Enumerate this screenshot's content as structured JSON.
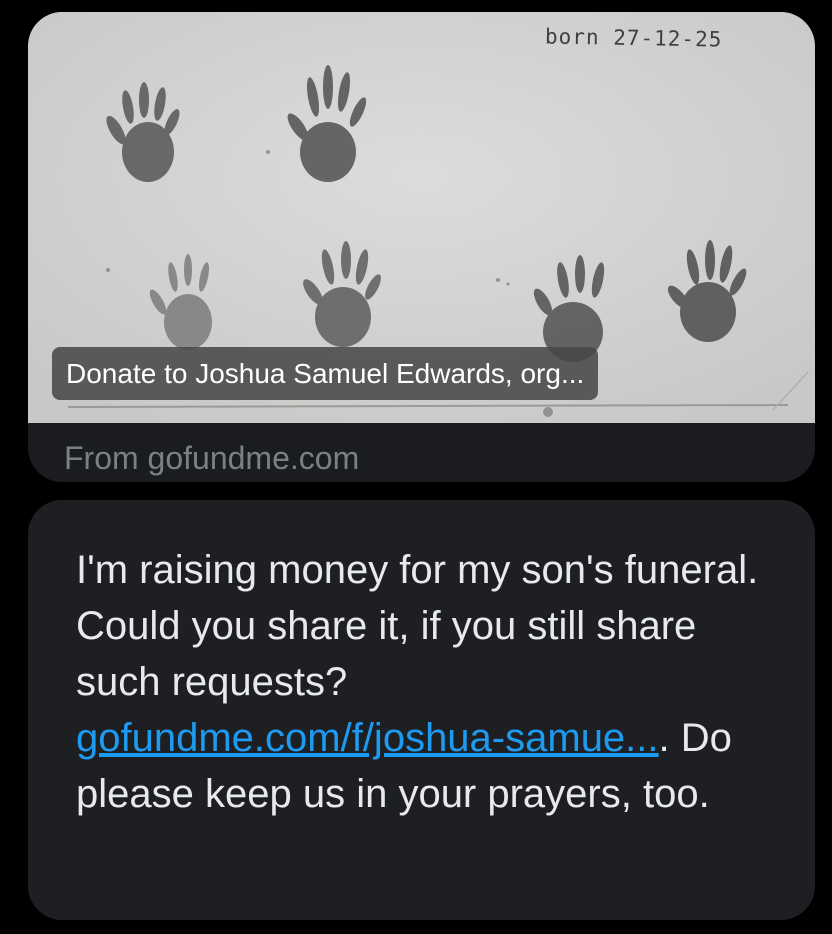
{
  "link_card": {
    "image_alt_text": "born 27-12-25",
    "caption": "Donate to Joshua Samuel Edwards, org...",
    "source": "From gofundme.com"
  },
  "message": {
    "text_before_link": "I'm raising money for my son's funeral. Could you share it, if you still share such requests? ",
    "link_text": "gofundme.com/f/joshua-samue...",
    "text_after_link": ". Do please keep us in your prayers, too."
  },
  "colors": {
    "background": "#000000",
    "bubble": "#1d1f23",
    "link": "#1d9bf0",
    "text": "#e7e9ea",
    "muted": "#7b8087"
  }
}
